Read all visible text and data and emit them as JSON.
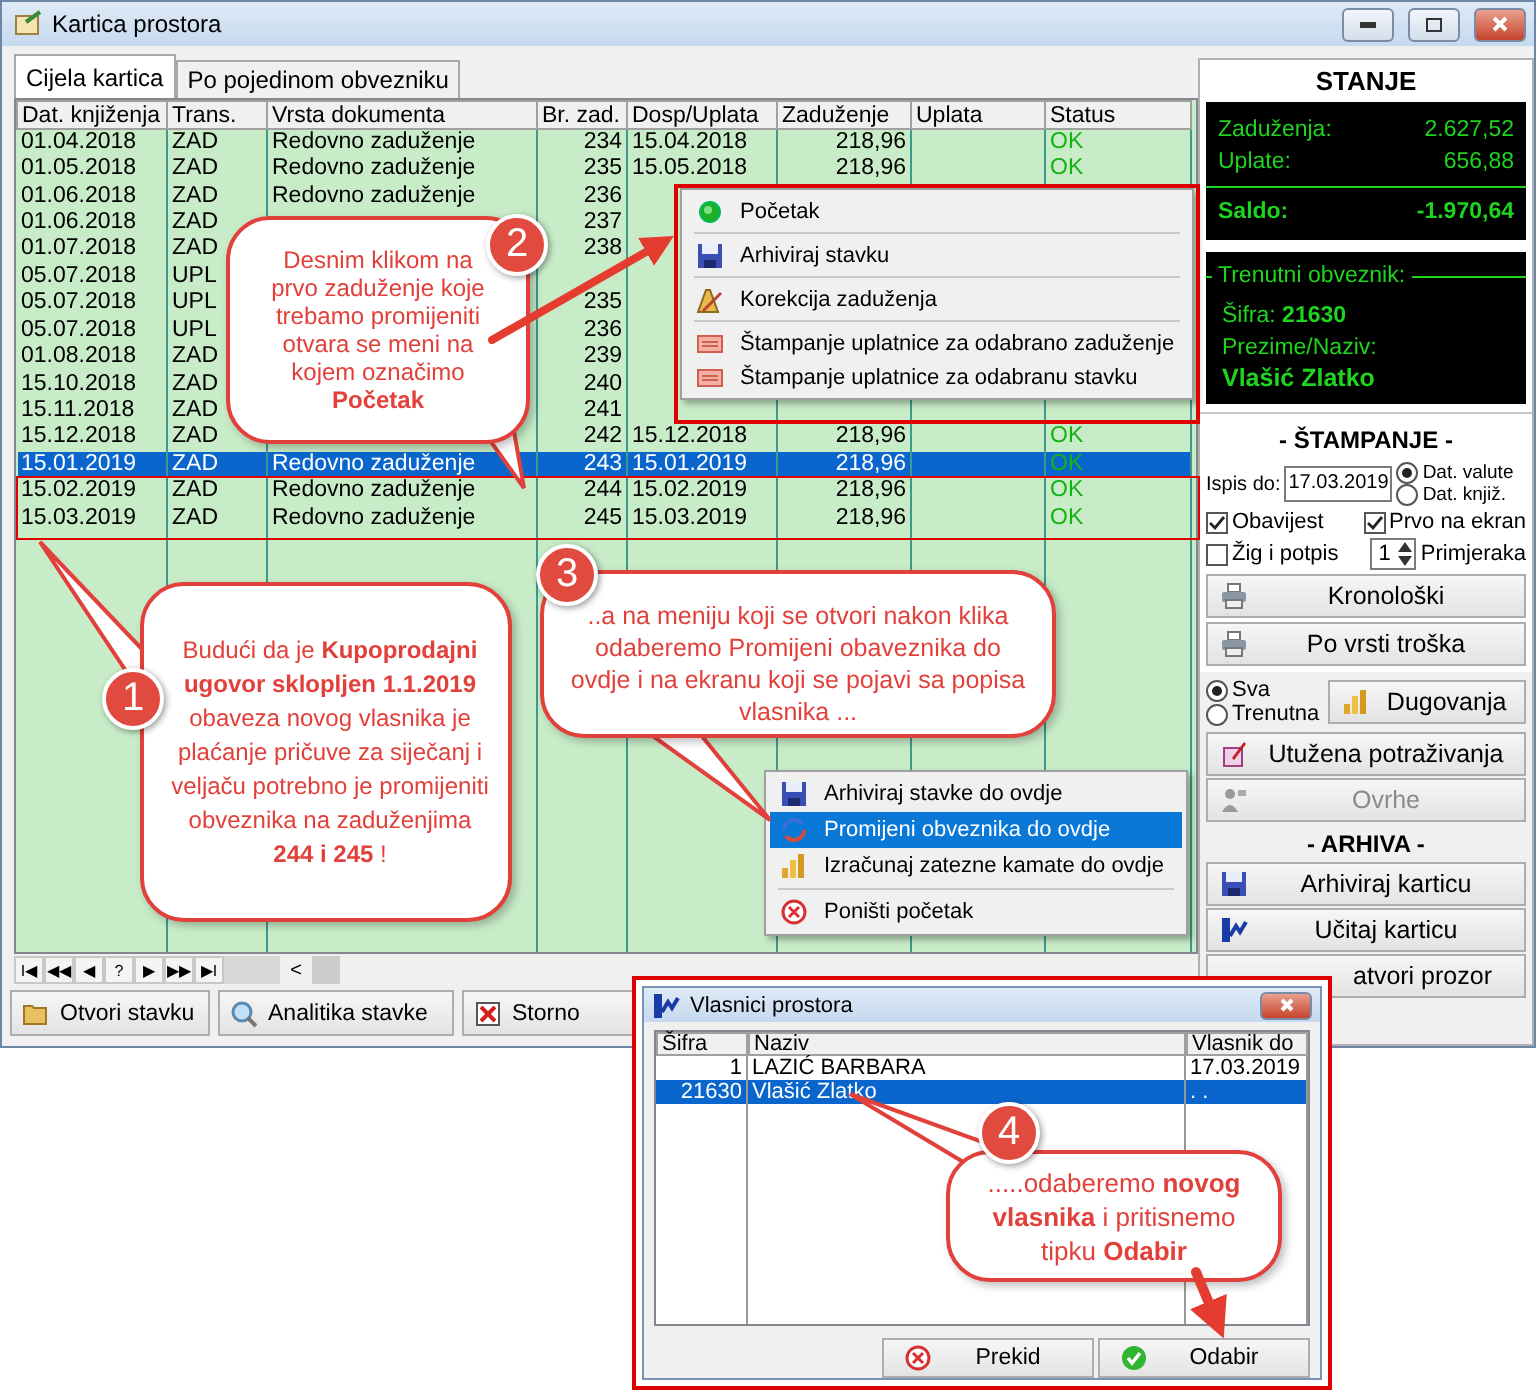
{
  "window": {
    "title": "Kartica prostora"
  },
  "tabs": [
    {
      "label": "Cijela kartica",
      "selected": true
    },
    {
      "label": "Po pojedinom obvezniku",
      "selected": false
    }
  ],
  "table": {
    "columns": [
      "Dat. knjiženja",
      "Trans.",
      "Vrsta dokumenta",
      "Br. zad.",
      "Dosp/Uplata",
      "Zaduženje",
      "Uplata",
      "Status"
    ],
    "rows": [
      {
        "selected": false,
        "cells": [
          "01.04.2018",
          "ZAD",
          "Redovno zaduženje",
          "234",
          "15.04.2018",
          "218,96",
          null,
          "OK"
        ]
      },
      {
        "selected": false,
        "cells": [
          "01.05.2018",
          "ZAD",
          "Redovno zaduženje",
          "235",
          "15.05.2018",
          "218,96",
          null,
          "OK"
        ]
      },
      {
        "selected": false,
        "cells": [
          "01.06.2018",
          "ZAD",
          "Redovno zaduženje",
          "236",
          null,
          null,
          null,
          null
        ]
      },
      {
        "selected": false,
        "cells": [
          "01.06.2018",
          "ZAD",
          null,
          "237",
          null,
          null,
          null,
          null
        ]
      },
      {
        "selected": false,
        "cells": [
          "01.07.2018",
          "ZAD",
          null,
          "238",
          null,
          null,
          null,
          null
        ]
      },
      {
        "selected": false,
        "cells": [
          "05.07.2018",
          "UPL",
          null,
          null,
          null,
          null,
          null,
          null
        ]
      },
      {
        "selected": false,
        "cells": [
          "05.07.2018",
          "UPL",
          null,
          "235",
          null,
          null,
          null,
          null
        ]
      },
      {
        "selected": false,
        "cells": [
          "05.07.2018",
          "UPL",
          null,
          "236",
          null,
          null,
          null,
          null
        ]
      },
      {
        "selected": false,
        "cells": [
          "01.08.2018",
          "ZAD",
          null,
          "239",
          null,
          null,
          null,
          null
        ]
      },
      {
        "selected": false,
        "cells": [
          "15.10.2018",
          "ZAD",
          null,
          "240",
          null,
          null,
          null,
          null
        ]
      },
      {
        "selected": false,
        "cells": [
          "15.11.2018",
          "ZAD",
          null,
          "241",
          null,
          null,
          null,
          null
        ]
      },
      {
        "selected": false,
        "cells": [
          "15.12.2018",
          "ZAD",
          null,
          "242",
          "15.12.2018",
          "218,96",
          null,
          "OK"
        ]
      },
      {
        "selected": true,
        "cells": [
          "15.01.2019",
          "ZAD",
          "Redovno zaduženje",
          "243",
          "15.01.2019",
          "218,96",
          null,
          "OK"
        ]
      },
      {
        "selected": false,
        "cells": [
          "15.02.2019",
          "ZAD",
          "Redovno zaduženje",
          "244",
          "15.02.2019",
          "218,96",
          null,
          "OK"
        ]
      },
      {
        "selected": false,
        "cells": [
          "15.03.2019",
          "ZAD",
          "Redovno zaduženje",
          "245",
          "15.03.2019",
          "218,96",
          null,
          "OK"
        ]
      }
    ]
  },
  "pager": [
    "I◀",
    "◀◀",
    "◀",
    "?",
    "▶",
    "▶▶",
    "▶I"
  ],
  "scroll_left": "<",
  "actions": [
    "Otvori stavku",
    "Analitika stavke",
    "Storno"
  ],
  "stanje": {
    "title": "STANJE",
    "rows": [
      {
        "label": "Zaduženja:",
        "value": "2.627,52"
      },
      {
        "label": "Uplate:",
        "value": "656,88"
      }
    ],
    "saldo": {
      "label": "Saldo:",
      "value": "-1.970,64"
    }
  },
  "obveznik": {
    "legend": "Trenutni obveznik:",
    "sifra_label": "Šifra:",
    "sifra": "21630",
    "naziv_label": "Prezime/Naziv:",
    "naziv": "Vlašić Zlatko"
  },
  "stampanje": {
    "title": "- ŠTAMPANJE -",
    "ispis_label": "Ispis do:",
    "ispis_value": "17.03.2019",
    "date_options": [
      {
        "label": "Dat. valute",
        "selected": true
      },
      {
        "label": "Dat. knjiž.",
        "selected": false
      }
    ],
    "checks": [
      {
        "label": "Obavijest",
        "checked": true
      },
      {
        "label": "Prvo na ekran",
        "checked": true
      },
      {
        "label": "Žig i potpis",
        "checked": false
      }
    ],
    "copies": {
      "value": "1",
      "label": "Primjeraka"
    },
    "buttons": [
      "Kronološki",
      "Po vrsti troška"
    ]
  },
  "scope": {
    "options": [
      {
        "label": "Sva",
        "selected": true
      },
      {
        "label": "Trenutna",
        "selected": false
      }
    ],
    "button": "Dugovanja"
  },
  "other_buttons": [
    {
      "label": "Utužena potraživanja",
      "disabled": false
    },
    {
      "label": "Ovrhe",
      "disabled": true
    }
  ],
  "arhiva": {
    "title": "- ARHIVA -",
    "buttons": [
      "Arhiviraj karticu",
      "Učitaj karticu",
      "atvori prozor"
    ]
  },
  "context_menu": [
    {
      "kind": "item",
      "label": "Početak",
      "selected": false
    },
    {
      "kind": "separator"
    },
    {
      "kind": "item",
      "label": "Arhiviraj stavku",
      "selected": false
    },
    {
      "kind": "separator"
    },
    {
      "kind": "item",
      "label": "Korekcija zaduženja",
      "selected": false
    },
    {
      "kind": "separator"
    },
    {
      "kind": "item",
      "label": "Štampanje uplatnice za odabrano zaduženje",
      "selected": false
    },
    {
      "kind": "item",
      "label": "Štampanje uplatnice za odabranu stavku",
      "selected": false
    }
  ],
  "context_menu_2": [
    {
      "kind": "item",
      "label": "Arhiviraj stavke do ovdje",
      "selected": false
    },
    {
      "kind": "item",
      "label": "Promijeni obveznika do ovdje",
      "selected": true
    },
    {
      "kind": "item",
      "label": "Izračunaj zatezne kamate do ovdje",
      "selected": false
    },
    {
      "kind": "separator"
    },
    {
      "kind": "item",
      "label": "Poništi početak",
      "selected": false
    }
  ],
  "dialog": {
    "title": "Vlasnici prostora",
    "columns": [
      "Šifra",
      "Naziv",
      "Vlasnik do"
    ],
    "rows": [
      {
        "selected": false,
        "cells": [
          "1",
          "LAZIĆ BARBARA",
          "17.03.2019"
        ]
      },
      {
        "selected": true,
        "cells": [
          "21630",
          "Vlašić Zlatko",
          ". ."
        ]
      }
    ],
    "buttons": [
      "Prekid",
      "Odabir"
    ]
  },
  "callouts": [
    {
      "number": "2",
      "text": "Desnim klikom na prvo zaduženje koje trebamo promijeniti otvara se meni na kojem označimo **Početak**"
    },
    {
      "number": "1",
      "text": "Budući da je **Kupoprodajni ugovor sklopljen 1.1.2019** obaveza novog vlasnika je plaćanje pričuve za siječanj i veljaču potrebno je promijeniti obveznika na zaduženjima **244 i 245** !"
    },
    {
      "number": "3",
      "text": "..a na meniju koji se otvori nakon klika odaberemo Promijeni obaveznika do ovdje i na ekranu koji se pojavi sa popisa vlasnika ..."
    },
    {
      "number": "4",
      "text": ".....odaberemo **novog vlasnika** i pritisnemo tipku **Odabir**"
    }
  ]
}
